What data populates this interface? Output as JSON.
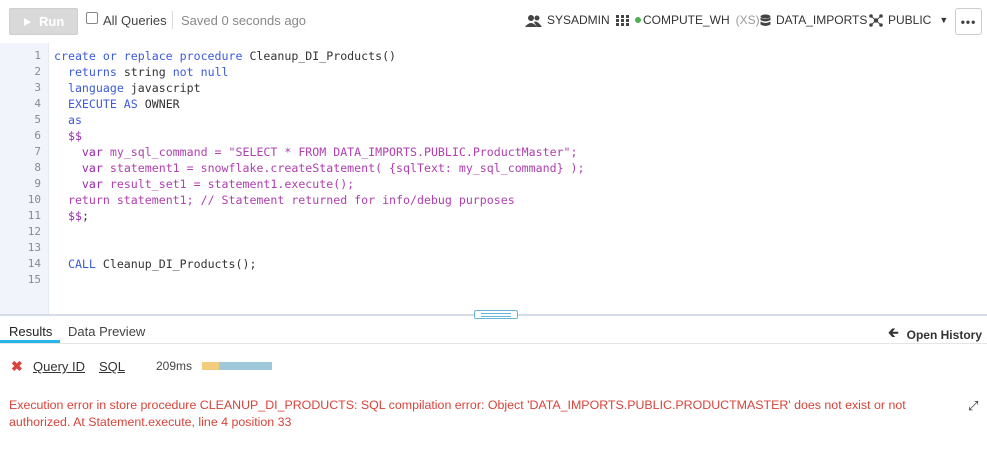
{
  "toolbar": {
    "run_label": "Run",
    "all_queries_label": "All Queries",
    "saved_status": "Saved 0 seconds ago",
    "role": "SYSADMIN",
    "warehouse": "COMPUTE_WH",
    "warehouse_size": "(XS)",
    "database": "DATA_IMPORTS",
    "schema": "PUBLIC",
    "more_label": "•••"
  },
  "editor": {
    "line_numbers": [
      "1",
      "2",
      "3",
      "4",
      "5",
      "6",
      "7",
      "8",
      "9",
      "10",
      "11",
      "12",
      "13",
      "14",
      "15"
    ]
  },
  "results": {
    "tab_results": "Results",
    "tab_preview": "Data Preview",
    "open_history": "Open History",
    "query_id_label": "Query ID",
    "sql_label": "SQL",
    "duration": "209ms",
    "error_message": "Execution error in store procedure CLEANUP_DI_PRODUCTS: SQL compilation error: Object 'DATA_IMPORTS.PUBLIC.PRODUCTMASTER' does not exist or not authorized. At Statement.execute, line 4 position 33"
  },
  "colors": {
    "accent": "#29b5e8",
    "error": "#d8433a"
  }
}
